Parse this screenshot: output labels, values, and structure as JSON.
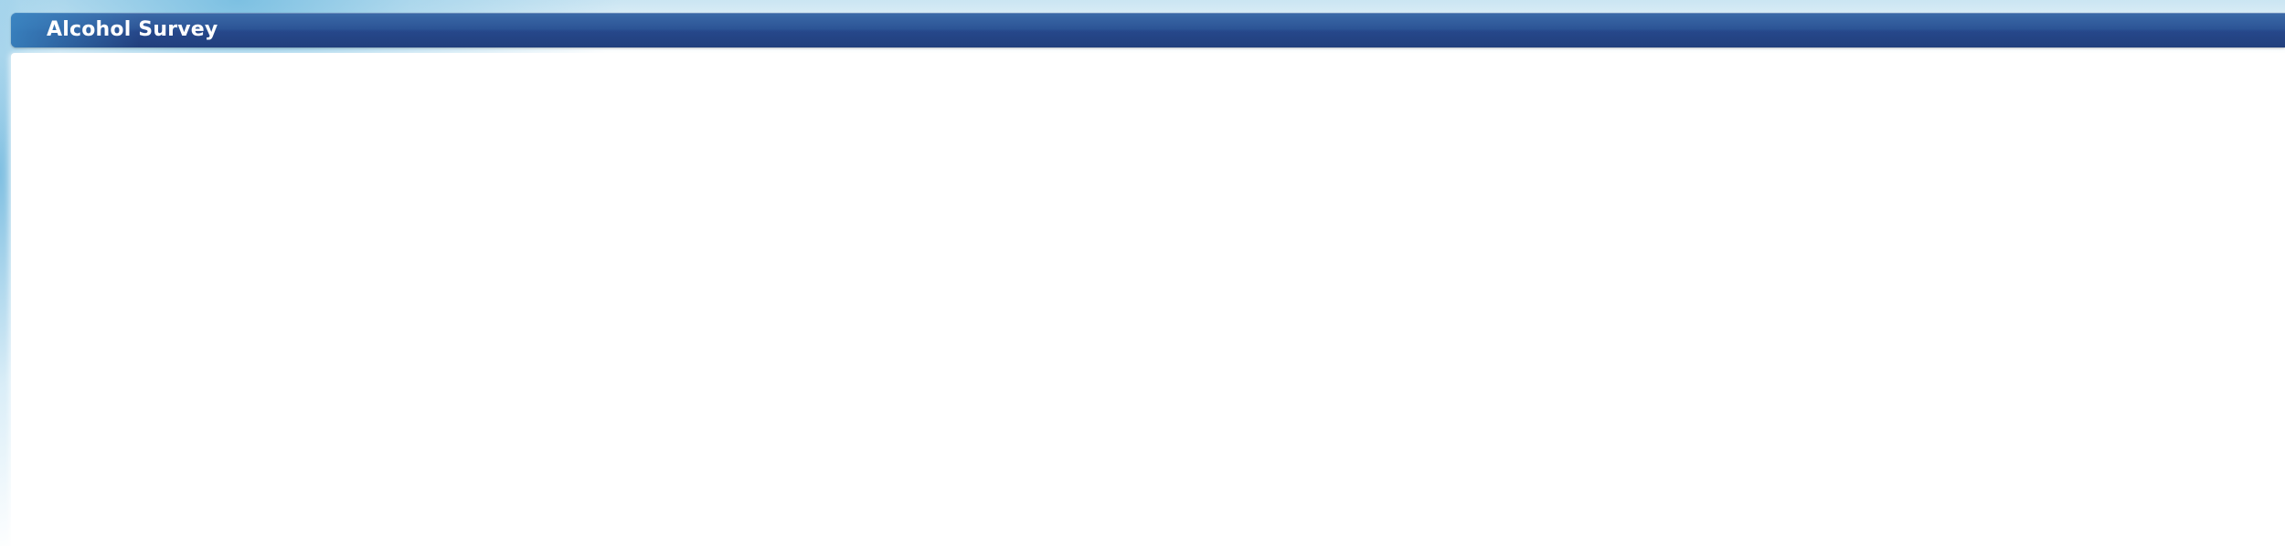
{
  "window": {
    "title": "Alcohol Survey"
  },
  "colors": {
    "title_bar": "#2a4f92",
    "title_text": "#ffffff",
    "backdrop_accent": "#78bee1",
    "content_background": "#ffffff"
  }
}
